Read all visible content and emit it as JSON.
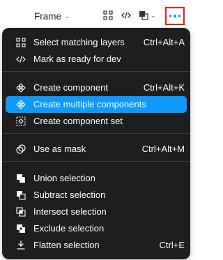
{
  "toolbar": {
    "frame_label": "Frame",
    "icons": [
      "grid-icon",
      "code-icon",
      "boolean-icon",
      "more-icon"
    ]
  },
  "menu": {
    "groups": [
      [
        {
          "label": "Select matching layers",
          "shortcut": "Ctrl+Alt+A",
          "icon": "select-matching-icon"
        },
        {
          "label": "Mark as ready for dev",
          "shortcut": "",
          "icon": "code-icon"
        }
      ],
      [
        {
          "label": "Create component",
          "shortcut": "Ctrl+Alt+K",
          "icon": "component-icon"
        },
        {
          "label": "Create multiple components",
          "shortcut": "",
          "icon": "component-icon",
          "active": true
        },
        {
          "label": "Create component set",
          "shortcut": "",
          "icon": "component-set-icon"
        }
      ],
      [
        {
          "label": "Use as mask",
          "shortcut": "Ctrl+Alt+M",
          "icon": "mask-icon"
        }
      ],
      [
        {
          "label": "Union selection",
          "shortcut": "",
          "icon": "union-icon"
        },
        {
          "label": "Subtract selection",
          "shortcut": "",
          "icon": "subtract-icon"
        },
        {
          "label": "Intersect selection",
          "shortcut": "",
          "icon": "intersect-icon"
        },
        {
          "label": "Exclude selection",
          "shortcut": "",
          "icon": "exclude-icon"
        },
        {
          "label": "Flatten selection",
          "shortcut": "Ctrl+E",
          "icon": "flatten-icon"
        }
      ]
    ]
  },
  "colors": {
    "menu_bg": "#1e1e1e",
    "active_bg": "#0d99ff",
    "highlight_border": "#e02020"
  }
}
